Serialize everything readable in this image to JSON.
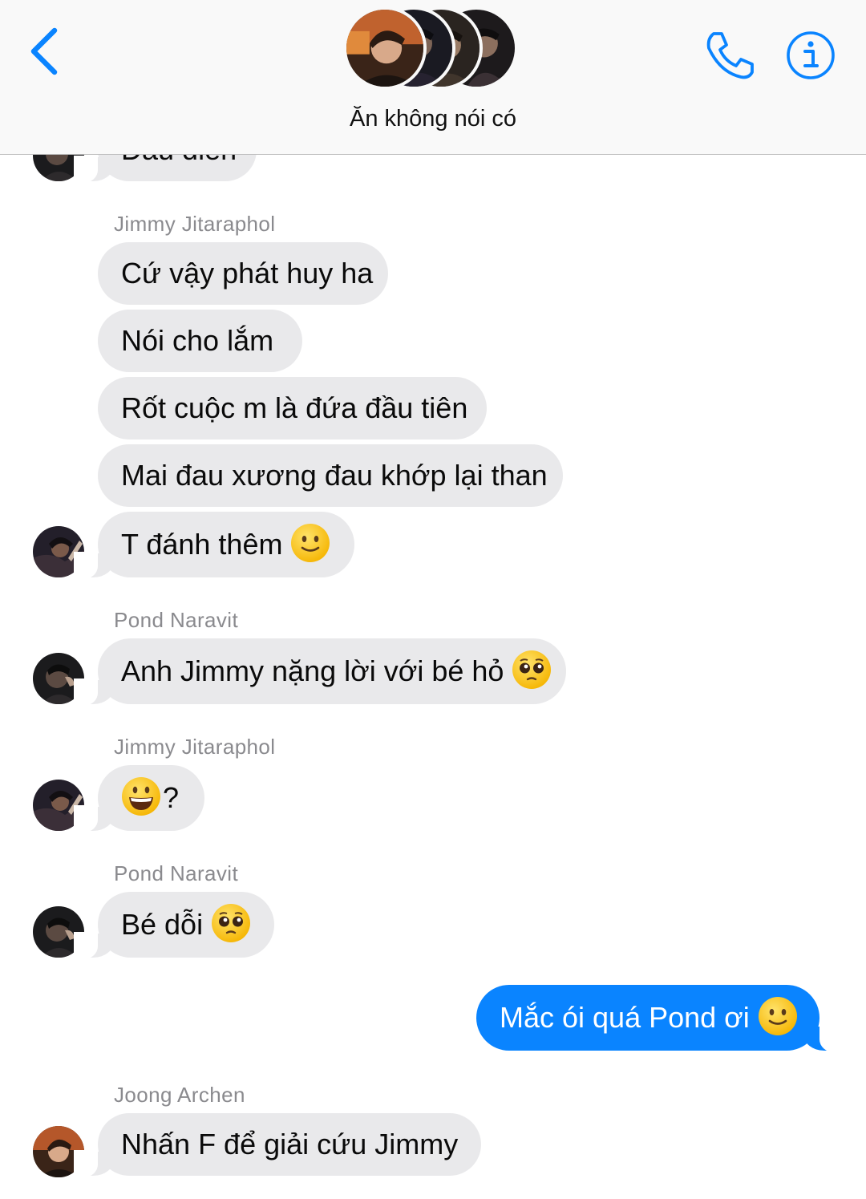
{
  "header": {
    "title": "Ăn không nói có",
    "back_icon": "chevron-left-icon",
    "call_icon": "phone-icon",
    "info_icon": "info-icon",
    "accent_color": "#0a84ff"
  },
  "messages": [
    {
      "type": "incoming",
      "text": "Đau diếh",
      "emoji": "",
      "avatar": "pond"
    },
    {
      "type": "sender",
      "name": "Jimmy Jitaraphol"
    },
    {
      "type": "incoming",
      "text": "Cứ vậy phát huy ha"
    },
    {
      "type": "incoming",
      "text": "Nói cho lắm"
    },
    {
      "type": "incoming",
      "text": "Rốt cuộc m là đứa đầu tiên"
    },
    {
      "type": "incoming",
      "text": "Mai đau xương đau khớp lại than"
    },
    {
      "type": "incoming",
      "text": "T đánh thêm",
      "emoji": "slightly-smiling-face",
      "avatar": "jimmy"
    },
    {
      "type": "sender",
      "name": "Pond Naravit"
    },
    {
      "type": "incoming",
      "text": "Anh Jimmy nặng lời với bé hỏ",
      "emoji": "pleading-face",
      "avatar": "pond"
    },
    {
      "type": "sender",
      "name": "Jimmy Jitaraphol"
    },
    {
      "type": "incoming",
      "text": "?",
      "emoji": "grinning-face",
      "avatar": "jimmy"
    },
    {
      "type": "sender",
      "name": "Pond Naravit"
    },
    {
      "type": "incoming",
      "text": "Bé dỗi",
      "emoji": "pleading-face",
      "avatar": "pond"
    },
    {
      "type": "outgoing",
      "text": "Mắc ói quá Pond ơi",
      "emoji": "slightly-smiling-face"
    },
    {
      "type": "sender",
      "name": "Joong Archen"
    },
    {
      "type": "incoming",
      "text": "Nhấn F để giải cứu Jimmy",
      "avatar": "joong"
    }
  ],
  "senders": {
    "jimmy_1": "Jimmy Jitaraphol",
    "pond_1": "Pond Naravit",
    "jimmy_2": "Jimmy Jitaraphol",
    "pond_2": "Pond Naravit",
    "joong": "Joong Archen"
  },
  "bubbles": {
    "m0": "Đau diếh",
    "m1": "Cứ vậy phát huy ha",
    "m2": "Nói cho lắm",
    "m3": "Rốt cuộc m là đứa đầu tiên",
    "m4": "Mai đau xương đau khớp lại than",
    "m5": "T đánh thêm",
    "m6": "Anh Jimmy nặng lời với bé hỏ",
    "m7": "?",
    "m8": "Bé dỗi",
    "m9": "Mắc ói quá Pond ơi",
    "m10": "Nhấn F để giải cứu Jimmy"
  },
  "colors": {
    "incoming_bubble": "#e9e9eb",
    "outgoing_bubble": "#0a84ff",
    "sender_name": "#8a8a8e"
  }
}
